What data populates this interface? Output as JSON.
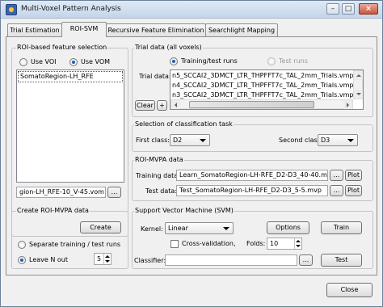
{
  "window": {
    "title": "Multi-Voxel Pattern Analysis",
    "controls": {
      "minimize": "–",
      "maximize": "□",
      "close": "×"
    }
  },
  "tabs": [
    {
      "label": "Trial Estimation",
      "active": false
    },
    {
      "label": "ROI-SVM",
      "active": true
    },
    {
      "label": "Recursive Feature Elimination",
      "active": false
    },
    {
      "label": "Searchlight Mapping",
      "active": false
    }
  ],
  "roi_feature": {
    "title": "ROI-based feature selection",
    "use_voi": "Use VOI",
    "use_vom": "Use VOM",
    "selected_mode": "Use VOM",
    "list_items": [
      "SomatoRegion-LH_RFE"
    ],
    "file_value": "gion-LH_RFE-10_V-45.vom",
    "browse_label": "..."
  },
  "trial_data": {
    "title": "Trial data (all voxels)",
    "mode_train_test": "Training/test runs",
    "mode_test_runs": "Test runs",
    "selected_mode": "Training/test runs",
    "label": "Trial data:",
    "files": [
      "n5_SCCAI2_3DMCT_LTR_THPFFT7c_TAL_2mm_Trials.vmp",
      "n4_SCCAI2_3DMCT_LTR_THPFFT7c_TAL_2mm_Trials.vmp",
      "n3_SCCAI2_3DMCT_LTR_THPFFT7c_TAL_2mm_Trials.vmp"
    ],
    "clear_label": "Clear",
    "add_label": "+"
  },
  "classification_task": {
    "title": "Selection of classification task",
    "first_label": "First class:",
    "first_value": "D2",
    "second_label": "Second class:",
    "second_value": "D3"
  },
  "roi_mvpa": {
    "title": "ROI-MVPA data",
    "training_label": "Training data:",
    "training_value": "Learn_SomatoRegion-LH-RFE_D2-D3_40-40.mvp",
    "test_label": "Test data:",
    "test_value": "Test_SomatoRegion-LH-RFE_D2-D3_5-5.mvp",
    "browse_label": "...",
    "plot_label": "Plot"
  },
  "create_mvpa": {
    "title": "Create ROI-MVPA data",
    "create_label": "Create",
    "separate_label": "Separate training / test runs",
    "leave_n_out_label": "Leave N out",
    "selected_mode": "Leave N out",
    "n_value": "5"
  },
  "svm": {
    "title": "Support Vector Machine (SVM)",
    "kernel_label": "Kernel:",
    "kernel_value": "Linear",
    "options_label": "Options",
    "train_label": "Train",
    "cross_validation_label": "Cross-validation,",
    "cross_validation_checked": false,
    "folds_label": "Folds:",
    "folds_value": "10",
    "classifier_label": "Classifier:",
    "classifier_value": "",
    "browse_label": "...",
    "test_label": "Test"
  },
  "footer": {
    "close_label": "Close"
  }
}
